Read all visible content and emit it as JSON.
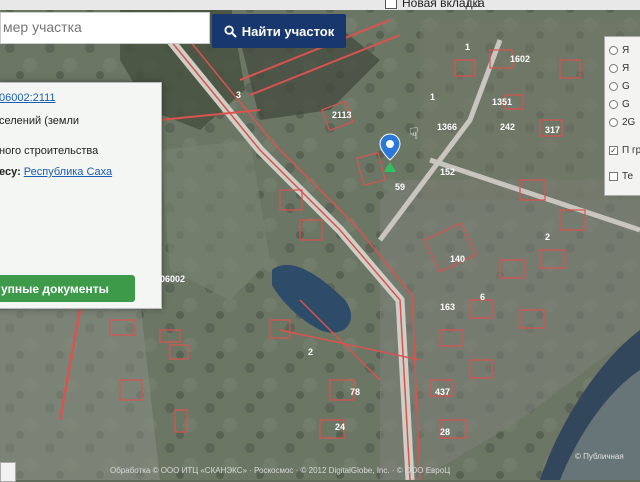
{
  "browser": {
    "tab_label": "Новая вкладка"
  },
  "search": {
    "placeholder": "мер участка",
    "button_label": "Найти участок"
  },
  "info_panel": {
    "cadastral_number": "06002:2111",
    "category": "селений (земли",
    "usage": "ного строительства",
    "address_prefix": "есу:",
    "address_link": "Республика Саха",
    "docs_button": "упные документы"
  },
  "map": {
    "parcel_label": "06002"
  },
  "layers": {
    "rows": [
      "Я",
      "Я",
      "G",
      "G",
      "2G"
    ],
    "check1": "П гр",
    "check2": "Те"
  },
  "attribution": {
    "text": "Обработка © ООО ИТЦ «СКАНЭКС» · Роскосмос · © 2012 DigitalGlobe, Inc. · © ООО ЕвроЦ",
    "right_text": "© Публичная"
  },
  "colors": {
    "search_button": "#17376e",
    "docs_button": "#3c9a49",
    "link": "#1a5fb4",
    "parcel_outline": "#d9534f",
    "marker": "#2b78d6"
  }
}
